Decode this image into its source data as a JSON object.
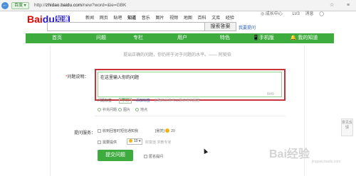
{
  "browser": {
    "back_icon": "←",
    "tab_label": "百度 ▾",
    "url_prefix": "http://",
    "url_domain": "zhidao.baidu.com",
    "url_rest": "/new?word=&ie=GBK",
    "star_icon": "☆",
    "menu_icon": "≡"
  },
  "header": {
    "logo_bai": "Bai",
    "logo_du": "du",
    "logo_zhidao": "知道",
    "nav": [
      "新闻",
      "网页",
      "贴吧",
      "知道",
      "音乐",
      "图片",
      "视频",
      "地图",
      "百科",
      "文库",
      "经验"
    ],
    "active_nav": "知道",
    "user_items": [
      "◎",
      "成长中心",
      "LV3",
      "消息",
      "◯"
    ],
    "search_button": "搜索答案",
    "ask_link": "我要提问"
  },
  "green_nav": {
    "items": [
      "首页",
      "问题",
      "专栏",
      "用户",
      "特色",
      "📱手机版",
      "🔔 我的知道"
    ]
  },
  "form": {
    "tip": "提出正确的问题，你仍将于对于问题的水平。—— 阿契伯",
    "question_label_req": "*",
    "question_label": "问题说明：",
    "question_text": "在这里输入你的问题",
    "counter": "8/49",
    "tag_label": "问题标签",
    "tag_chip": "学习",
    "tag_add": "+添加标签",
    "tag_hint": "正确的分类可以更快得到回答",
    "option_supplement": "补充问题",
    "option_image": "图片",
    "option_location": "地点",
    "service_label": "提问服务：",
    "service_phone": "收到回答时短信通知我",
    "reward_label": "[悬赏]",
    "reward_value": "20",
    "row2_label": "需要提供",
    "select_value": "10",
    "row2_hint": "财富值 求教专家",
    "submit": "提交问题",
    "anonymous": "匿名提问"
  },
  "sidebar": {
    "feedback": "意见反馈"
  },
  "watermark": {
    "text": "Bai经验",
    "sub": "jingyan.baidu.com"
  }
}
